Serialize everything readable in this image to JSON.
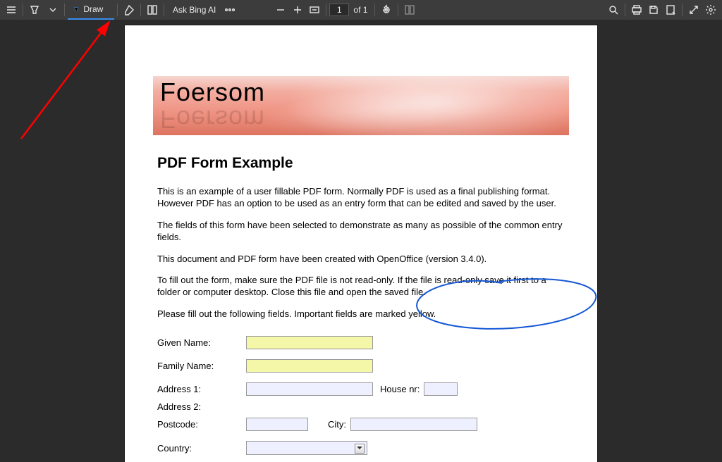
{
  "toolbar": {
    "draw_label": "Draw",
    "ask_label": "Ask Bing AI",
    "page_value": "1",
    "page_of": "of 1"
  },
  "banner": {
    "brand": "Foersom"
  },
  "doc": {
    "title": "PDF Form Example",
    "p1": "This is an example of a user fillable PDF form. Normally PDF is used as a final publishing format. However PDF has an option to be used as an entry form that can be edited and saved by the user.",
    "p2": "The fields of this form have been selected to demonstrate as many as possible of the common entry fields.",
    "p3": "This document and PDF form have been created with OpenOffice (version 3.4.0).",
    "p4": "To fill out the form, make sure the PDF file is not read-only. If the file is read-only save it first to a folder or computer desktop. Close this file and open the saved file.",
    "p5": "Please fill out the following fields. Important fields are marked yellow."
  },
  "form": {
    "given_name": "Given Name:",
    "family_name": "Family Name:",
    "address1": "Address 1:",
    "address2": "Address 2:",
    "house_nr": "House nr:",
    "postcode": "Postcode:",
    "city": "City:",
    "country": "Country:"
  }
}
